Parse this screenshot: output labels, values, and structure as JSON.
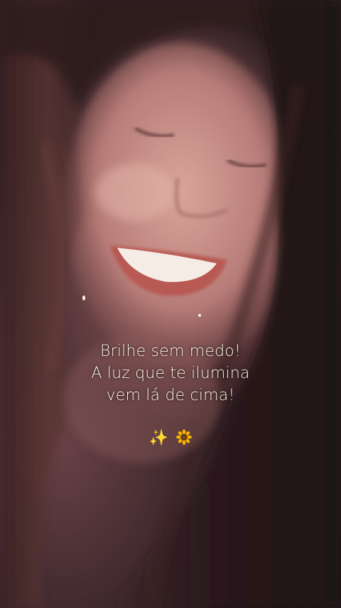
{
  "caption": {
    "line1": "Brilhe sem medo!",
    "line2": "A luz que te ilumina",
    "line3": "vem lá de cima!"
  },
  "decoration": {
    "sparkles_glyph": "✨",
    "sunflower_icon": "sunflower-icon"
  },
  "colors": {
    "caption_text": "#fff6e8",
    "sparkles": "#ffd966",
    "sunflower_petals": "#f4b400",
    "sunflower_center": "#5a3310"
  }
}
